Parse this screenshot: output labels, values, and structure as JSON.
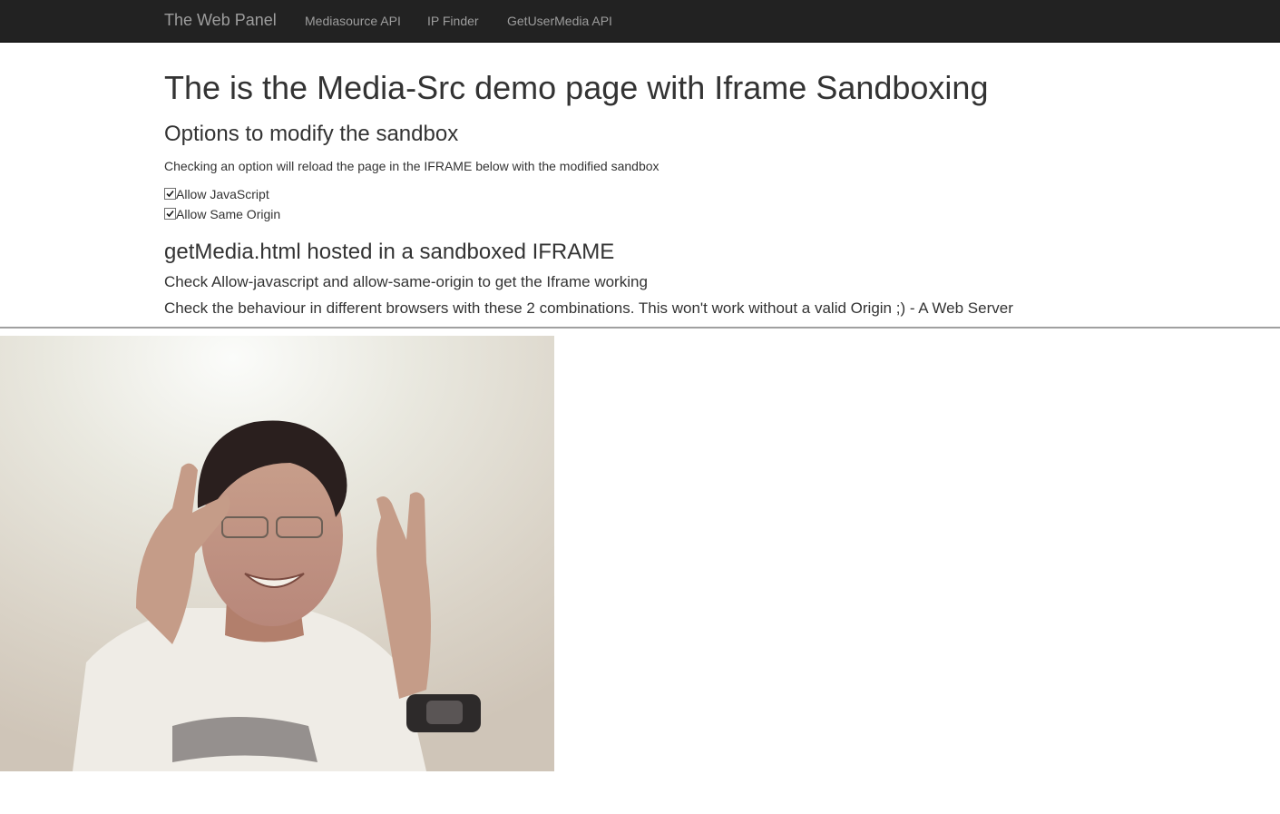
{
  "navbar": {
    "brand": "The Web Panel",
    "links": [
      {
        "label": "Mediasource API"
      },
      {
        "label": "IP Finder"
      },
      {
        "label": "GetUserMedia API"
      }
    ]
  },
  "page": {
    "title": "The is the Media-Src demo page with Iframe Sandboxing",
    "options_heading": "Options to modify the sandbox",
    "options_help": "Checking an option will reload the page in the IFRAME below with the modified sandbox",
    "options": [
      {
        "label": "Allow JavaScript",
        "checked": true
      },
      {
        "label": "Allow Same Origin",
        "checked": true
      }
    ],
    "iframe_heading": "getMedia.html hosted in a sandboxed IFRAME",
    "instructions": [
      "Check Allow-javascript and allow-same-origin to get the Iframe working",
      "Check the behaviour in different browsers with these 2 combinations. This won't work without a valid Origin ;) - A Web Server"
    ]
  },
  "iframe": {
    "video_description": "webcam-video-feed"
  },
  "colors": {
    "navbar_bg": "#222222",
    "nav_text": "#9d9d9d",
    "body_text": "#333333"
  }
}
